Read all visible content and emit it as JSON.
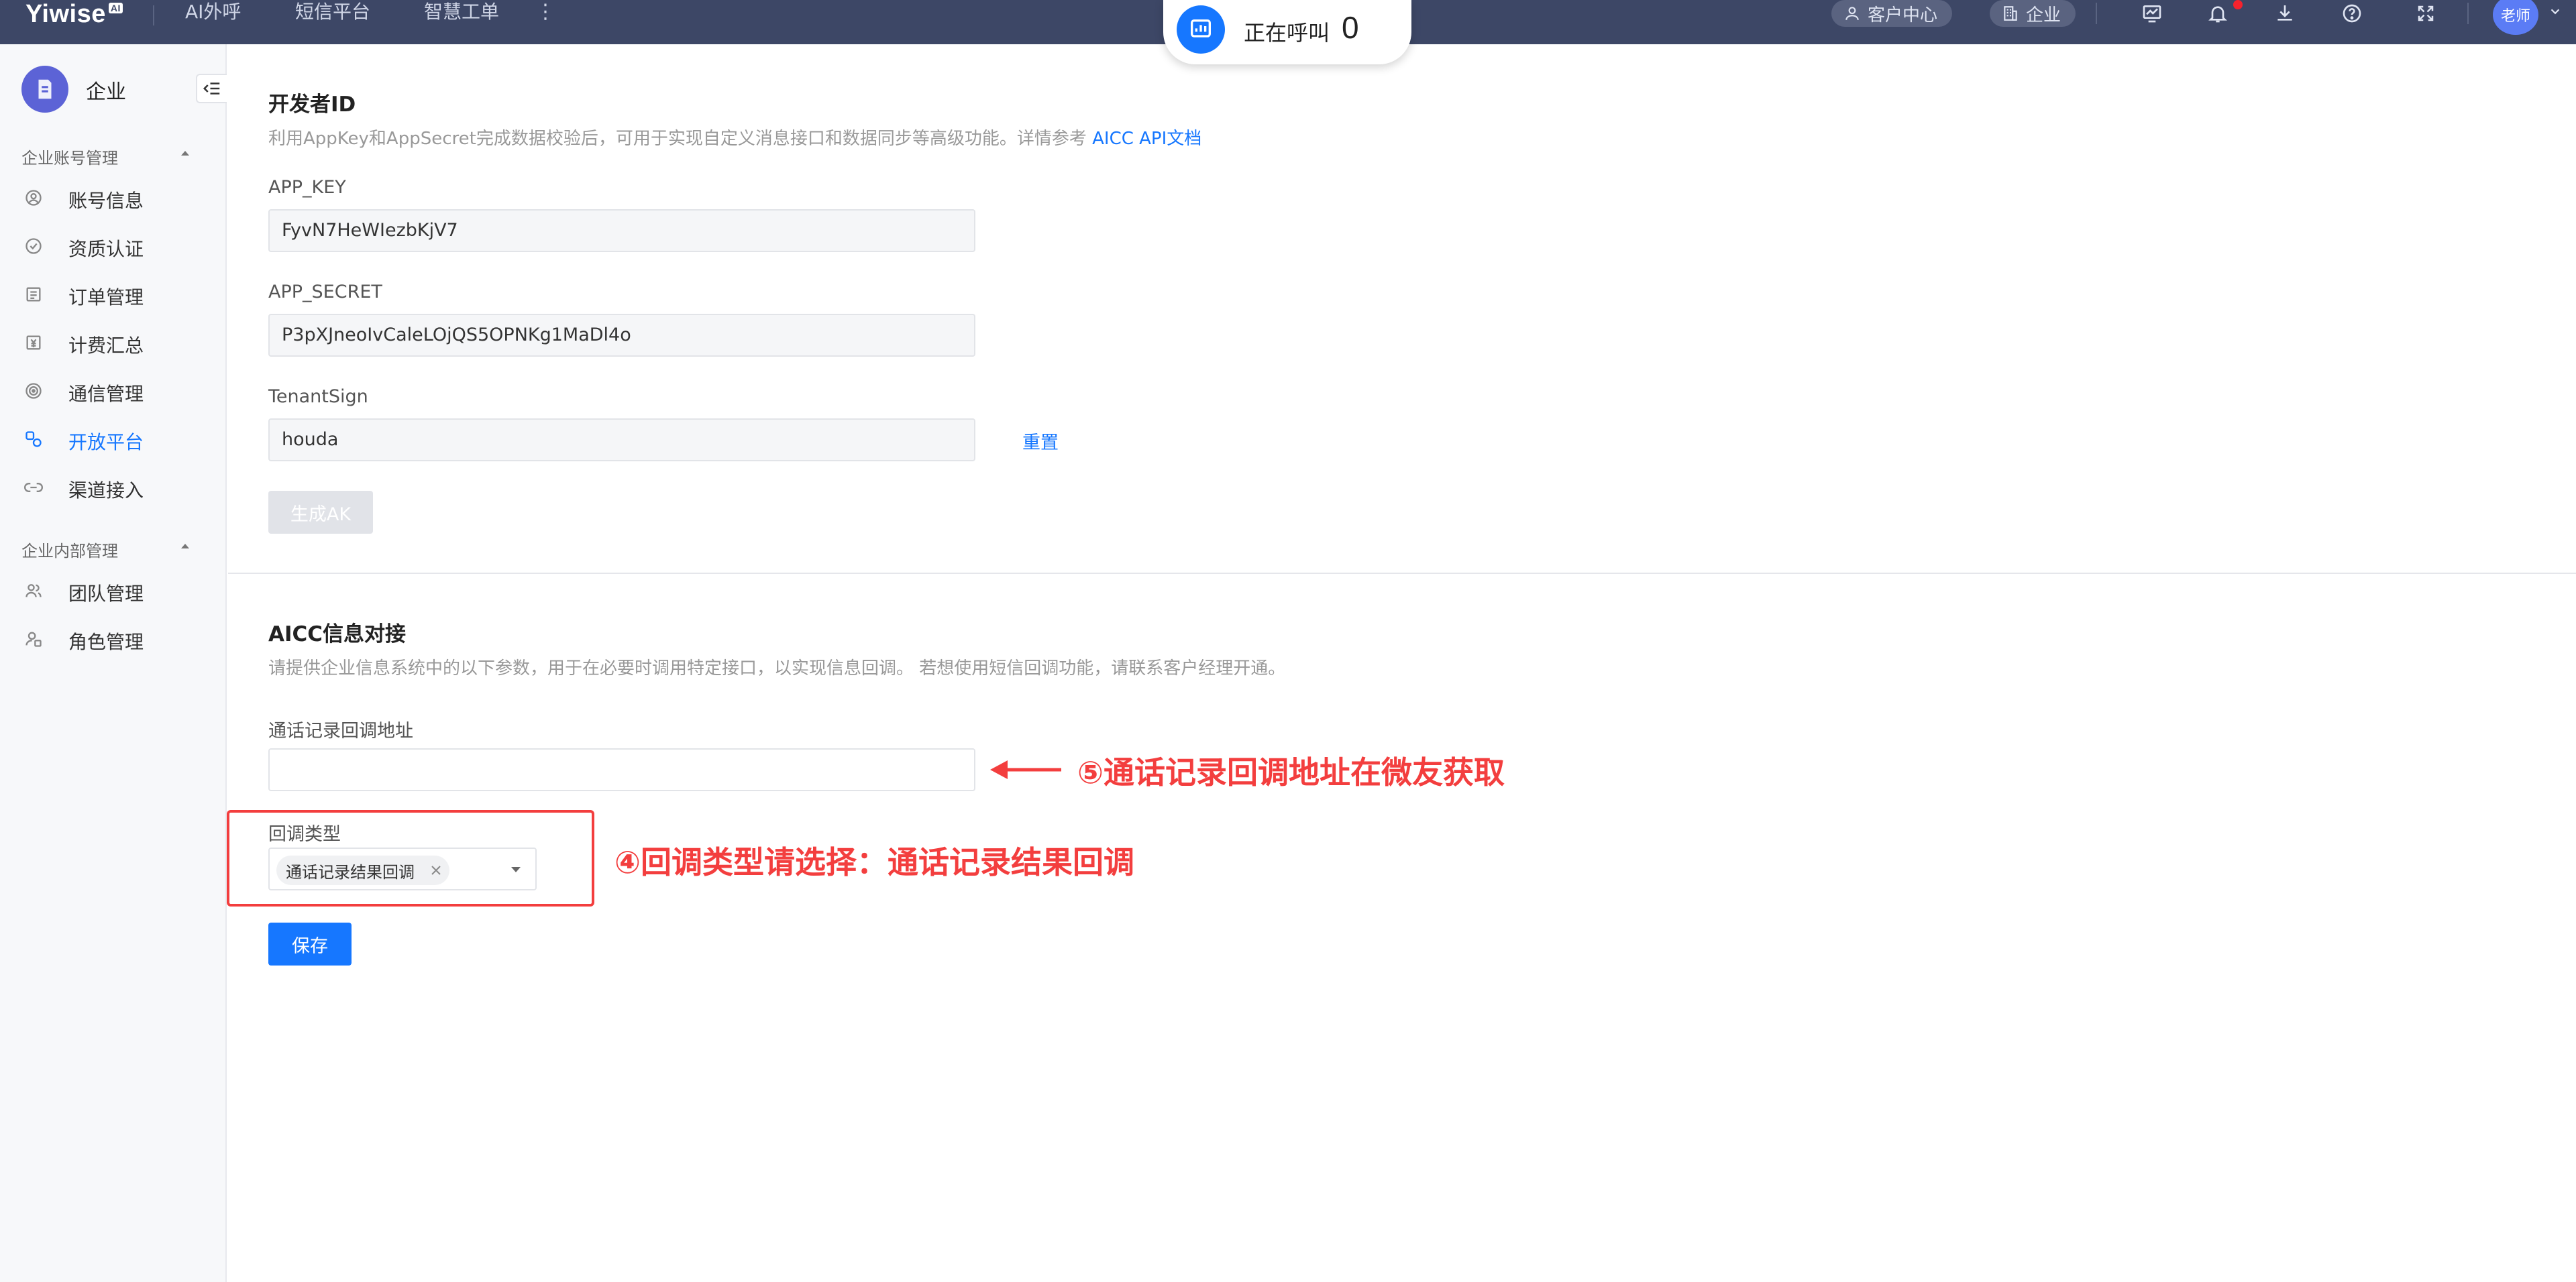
{
  "topbar": {
    "logo": "Yiwise",
    "logo_sup": "AI",
    "nav": [
      "AI外呼",
      "短信平台",
      "智慧工单"
    ],
    "more_glyph": "⋮",
    "call_status_label": "正在呼叫",
    "call_status_count": "0",
    "customer_center_label": "客户中心",
    "enterprise_label": "企业",
    "user_avatar_text": "老师",
    "icons": [
      "monitor-icon",
      "bell-icon",
      "download-icon",
      "help-icon",
      "fullscreen-icon"
    ],
    "colors": {
      "bar": "#3d4766",
      "notification": "#f5222d",
      "avatar": "#5b7cf5"
    }
  },
  "sidebar": {
    "title": "企业",
    "groups": [
      {
        "title": "企业账号管理",
        "items": [
          {
            "label": "账号信息",
            "icon": "user-circle-icon"
          },
          {
            "label": "资质认证",
            "icon": "check-circle-icon"
          },
          {
            "label": "订单管理",
            "icon": "order-icon"
          },
          {
            "label": "计费汇总",
            "icon": "billing-icon"
          },
          {
            "label": "通信管理",
            "icon": "signal-icon"
          },
          {
            "label": "开放平台",
            "icon": "open-platform-icon",
            "active": true
          },
          {
            "label": "渠道接入",
            "icon": "channel-icon"
          }
        ]
      },
      {
        "title": "企业内部管理",
        "items": [
          {
            "label": "团队管理",
            "icon": "team-icon"
          },
          {
            "label": "角色管理",
            "icon": "role-icon"
          }
        ]
      }
    ]
  },
  "developer": {
    "title": "开发者ID",
    "desc_prefix": "利用AppKey和AppSecret完成数据校验后，可用于实现自定义消息接口和数据同步等高级功能。详情参考 ",
    "desc_link": "AICC API文档",
    "app_key_label": "APP_KEY",
    "app_key_value": "FyvN7HeWIezbKjV7",
    "app_secret_label": "APP_SECRET",
    "app_secret_value": "P3pXJneoIvCaleLOjQS5OPNKg1MaDl4o",
    "tenant_label": "TenantSign",
    "tenant_value": "houda",
    "reset_label": "重置",
    "generate_label": "生成AK"
  },
  "aicc": {
    "title": "AICC信息对接",
    "desc": "请提供企业信息系统中的以下参数，用于在必要时调用特定接口，以实现信息回调。 若想使用短信回调功能，请联系客户经理开通。",
    "callback_url_label": "通话记录回调地址",
    "callback_url_value": "",
    "callback_type_label": "回调类型",
    "callback_type_selected": "通话记录结果回调",
    "save_label": "保存"
  },
  "annotations": {
    "step5": "⑤通话记录回调地址在微友获取",
    "step4": "④回调类型请选择：通话记录结果回调",
    "color": "#f33e3e"
  }
}
